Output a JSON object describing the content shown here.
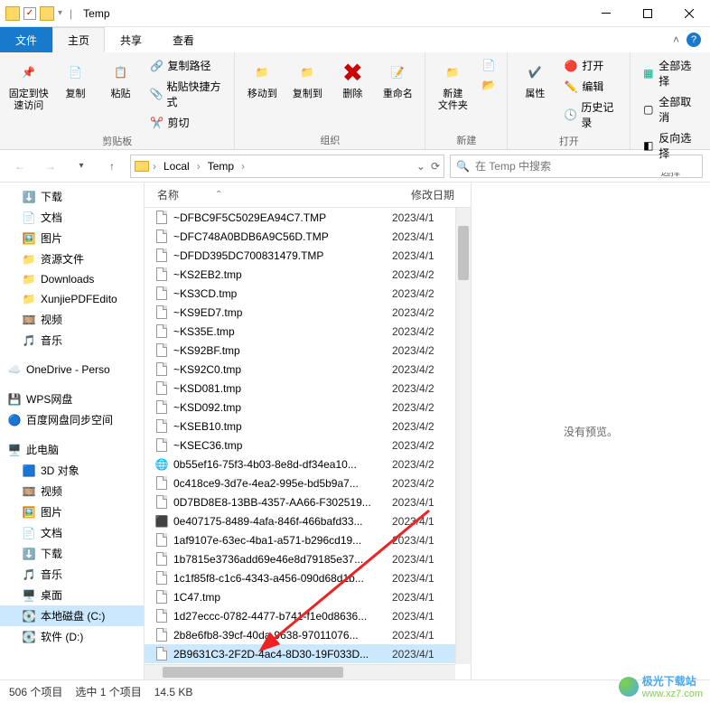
{
  "window": {
    "title": "Temp"
  },
  "tabs": {
    "file": "文件",
    "home": "主页",
    "share": "共享",
    "view": "查看"
  },
  "ribbon": {
    "pin": "固定到快\n速访问",
    "copy": "复制",
    "paste": "粘贴",
    "copy_path": "复制路径",
    "paste_shortcut": "粘贴快捷方式",
    "cut": "剪切",
    "clipboard_label": "剪贴板",
    "move_to": "移动到",
    "copy_to": "复制到",
    "delete": "删除",
    "rename": "重命名",
    "organize_label": "组织",
    "new_folder": "新建\n文件夹",
    "new_label": "新建",
    "properties": "属性",
    "open": "打开",
    "edit": "编辑",
    "history": "历史记录",
    "open_label": "打开",
    "select_all": "全部选择",
    "select_none": "全部取消",
    "invert": "反向选择",
    "select_label": "选择"
  },
  "address": {
    "crumbs": [
      "Local",
      "Temp"
    ],
    "search_placeholder": "在 Temp 中搜索"
  },
  "tree": {
    "items": [
      {
        "label": "下载",
        "icon": "download",
        "indent": 1
      },
      {
        "label": "文档",
        "icon": "docs",
        "indent": 1
      },
      {
        "label": "图片",
        "icon": "pics",
        "indent": 1
      },
      {
        "label": "资源文件",
        "icon": "folder",
        "indent": 1
      },
      {
        "label": "Downloads",
        "icon": "folder",
        "indent": 1
      },
      {
        "label": "XunjiePDFEdito",
        "icon": "folder",
        "indent": 1
      },
      {
        "label": "视频",
        "icon": "video",
        "indent": 1
      },
      {
        "label": "音乐",
        "icon": "music",
        "indent": 1
      },
      {
        "label": "OneDrive - Perso",
        "icon": "onedrive",
        "indent": 0,
        "spaced": true
      },
      {
        "label": "WPS网盘",
        "icon": "wps",
        "indent": 0,
        "spaced": true
      },
      {
        "label": "百度网盘同步空间",
        "icon": "baidu",
        "indent": 0
      },
      {
        "label": "此电脑",
        "icon": "pc",
        "indent": 0,
        "spaced": true
      },
      {
        "label": "3D 对象",
        "icon": "3d",
        "indent": 1
      },
      {
        "label": "视频",
        "icon": "video",
        "indent": 1
      },
      {
        "label": "图片",
        "icon": "pics",
        "indent": 1
      },
      {
        "label": "文档",
        "icon": "docs",
        "indent": 1
      },
      {
        "label": "下载",
        "icon": "download",
        "indent": 1
      },
      {
        "label": "音乐",
        "icon": "music",
        "indent": 1
      },
      {
        "label": "桌面",
        "icon": "desktop",
        "indent": 1
      },
      {
        "label": "本地磁盘 (C:)",
        "icon": "disk",
        "indent": 1,
        "selected": true
      },
      {
        "label": "软件 (D:)",
        "icon": "disk",
        "indent": 1
      }
    ]
  },
  "columns": {
    "name": "名称",
    "date": "修改日期"
  },
  "files": [
    {
      "name": "~DFBC9F5C5029EA94C7.TMP",
      "date": "2023/4/1",
      "icon": "file"
    },
    {
      "name": "~DFC748A0BDB6A9C56D.TMP",
      "date": "2023/4/1",
      "icon": "file"
    },
    {
      "name": "~DFDD395DC700831479.TMP",
      "date": "2023/4/1",
      "icon": "file"
    },
    {
      "name": "~KS2EB2.tmp",
      "date": "2023/4/2",
      "icon": "file"
    },
    {
      "name": "~KS3CD.tmp",
      "date": "2023/4/2",
      "icon": "file"
    },
    {
      "name": "~KS9ED7.tmp",
      "date": "2023/4/2",
      "icon": "file"
    },
    {
      "name": "~KS35E.tmp",
      "date": "2023/4/2",
      "icon": "file"
    },
    {
      "name": "~KS92BF.tmp",
      "date": "2023/4/2",
      "icon": "file"
    },
    {
      "name": "~KS92C0.tmp",
      "date": "2023/4/2",
      "icon": "file"
    },
    {
      "name": "~KSD081.tmp",
      "date": "2023/4/2",
      "icon": "file"
    },
    {
      "name": "~KSD092.tmp",
      "date": "2023/4/2",
      "icon": "file"
    },
    {
      "name": "~KSEB10.tmp",
      "date": "2023/4/2",
      "icon": "file"
    },
    {
      "name": "~KSEC36.tmp",
      "date": "2023/4/2",
      "icon": "file"
    },
    {
      "name": "0b55ef16-75f3-4b03-8e8d-df34ea10...",
      "date": "2023/4/2",
      "icon": "edge"
    },
    {
      "name": "0c418ce9-3d7e-4ea2-995e-bd5b9a7...",
      "date": "2023/4/2",
      "icon": "file"
    },
    {
      "name": "0D7BD8E8-13BB-4357-AA66-F302519...",
      "date": "2023/4/1",
      "icon": "file"
    },
    {
      "name": "0e407175-8489-4afa-846f-466bafd33...",
      "date": "2023/4/1",
      "icon": "dark"
    },
    {
      "name": "1af9107e-63ec-4ba1-a571-b296cd19...",
      "date": "2023/4/1",
      "icon": "file"
    },
    {
      "name": "1b7815e3736add69e46e8d79185e37...",
      "date": "2023/4/1",
      "icon": "file"
    },
    {
      "name": "1c1f85f8-c1c6-4343-a456-090d68d1b...",
      "date": "2023/4/1",
      "icon": "file"
    },
    {
      "name": "1C47.tmp",
      "date": "2023/4/1",
      "icon": "file"
    },
    {
      "name": "1d27eccc-0782-4477-b741-f1e0d8636...",
      "date": "2023/4/1",
      "icon": "file"
    },
    {
      "name": "2b8e6fb8-39cf-40da-9638-97011076...",
      "date": "2023/4/1",
      "icon": "file"
    },
    {
      "name": "2B9631C3-2F2D-4ac4-8D30-19F033D...",
      "date": "2023/4/1",
      "icon": "file",
      "selected": true
    }
  ],
  "preview": {
    "no_preview": "没有预览。"
  },
  "status": {
    "items": "506 个项目",
    "selected": "选中 1 个项目",
    "size": "14.5 KB"
  },
  "watermark": {
    "name": "极光下载站",
    "url": "www.xz7.com"
  }
}
